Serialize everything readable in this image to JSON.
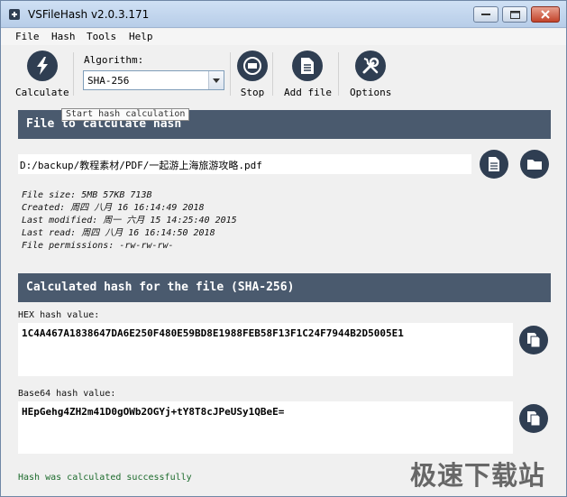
{
  "window": {
    "title": "VSFileHash v2.0.3.171"
  },
  "menu": [
    "File",
    "Hash",
    "Tools",
    "Help"
  ],
  "toolbar": {
    "calculate": "Calculate",
    "algorithm_label": "Algorithm:",
    "algorithm_value": "SHA-256",
    "stop": "Stop",
    "add_file": "Add file",
    "options": "Options"
  },
  "tooltip": "Start hash calculation",
  "file_section": {
    "header": "File to calculate hash",
    "path": "D:/backup/教程素材/PDF/一起游上海旅游攻略.pdf",
    "info": [
      "File size: 5MB 57KB 713B",
      "Created: 周四 八月 16 16:14:49 2018",
      "Last modified: 周一 六月 15 14:25:40 2015",
      "Last read: 周四 八月 16 16:14:50 2018",
      "File permissions: -rw-rw-rw-"
    ]
  },
  "hash_section": {
    "header": "Calculated hash for the file (SHA-256)",
    "hex_label": "HEX hash value:",
    "hex_value": "1C4A467A1838647DA6E250F480E59BD8E1988FEB58F13F1C24F7944B2D5005E1",
    "base64_label": "Base64 hash value:",
    "base64_value": "HEpGehg4ZH2m41D0gOWb2OGYj+tY8T8cJPeUSy1QBeE="
  },
  "status": "Hash was calculated successfully",
  "watermark": "极速下载站",
  "colors": {
    "header_bg": "#4a5a6e",
    "icon_bg": "#2f3e52",
    "status_text": "#1c6b2c"
  }
}
